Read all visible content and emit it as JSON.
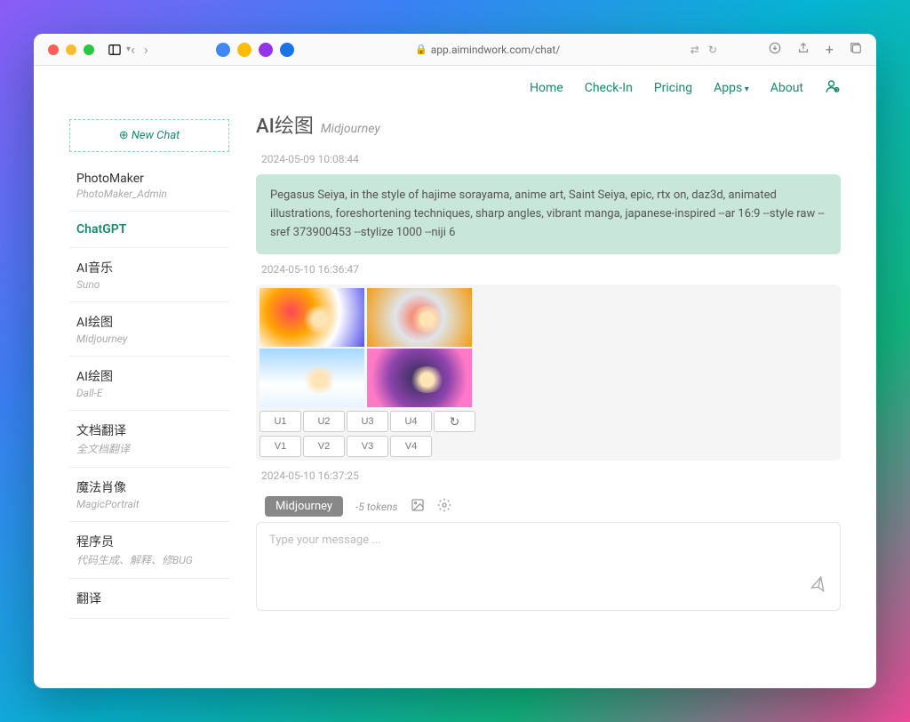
{
  "browser": {
    "url": "app.aimindwork.com/chat/"
  },
  "nav": {
    "home": "Home",
    "checkin": "Check-In",
    "pricing": "Pricing",
    "apps": "Apps",
    "about": "About"
  },
  "sidebar": {
    "new_chat": "New Chat",
    "items": [
      {
        "title": "PhotoMaker",
        "sub": "PhotoMaker_Admin",
        "active": false
      },
      {
        "title": "ChatGPT",
        "sub": "",
        "active": true
      },
      {
        "title": "AI音乐",
        "sub": "Suno",
        "active": false
      },
      {
        "title": "AI绘图",
        "sub": "Midjourney",
        "active": false
      },
      {
        "title": "AI绘图",
        "sub": "Dall-E",
        "active": false
      },
      {
        "title": "文档翻译",
        "sub": "全文档翻译",
        "active": false
      },
      {
        "title": "魔法肖像",
        "sub": "MagicPortrait",
        "active": false
      },
      {
        "title": "程序员",
        "sub": "代码生成、解释、修BUG",
        "active": false
      },
      {
        "title": "翻译",
        "sub": "",
        "active": false
      }
    ]
  },
  "chat": {
    "title": "AI绘图",
    "subtitle": "Midjourney",
    "ts1": "2024-05-09 10:08:44",
    "user_msg": "Pegasus Seiya, in the style of hajime sorayama, anime art, Saint Seiya, epic, rtx on, daz3d, animated illustrations, foreshortening techniques, sharp angles, vibrant manga, japanese-inspired --ar 16:9 --style raw --sref 373900453 --stylize 1000 --niji 6",
    "ts2": "2024-05-10 16:36:47",
    "ts3": "2024-05-10 16:37:25",
    "buttons_u": [
      "U1",
      "U2",
      "U3",
      "U4"
    ],
    "buttons_v": [
      "V1",
      "V2",
      "V3",
      "V4"
    ]
  },
  "input": {
    "mode": "Midjourney",
    "tokens": "-5 tokens",
    "placeholder": "Type your message ..."
  }
}
